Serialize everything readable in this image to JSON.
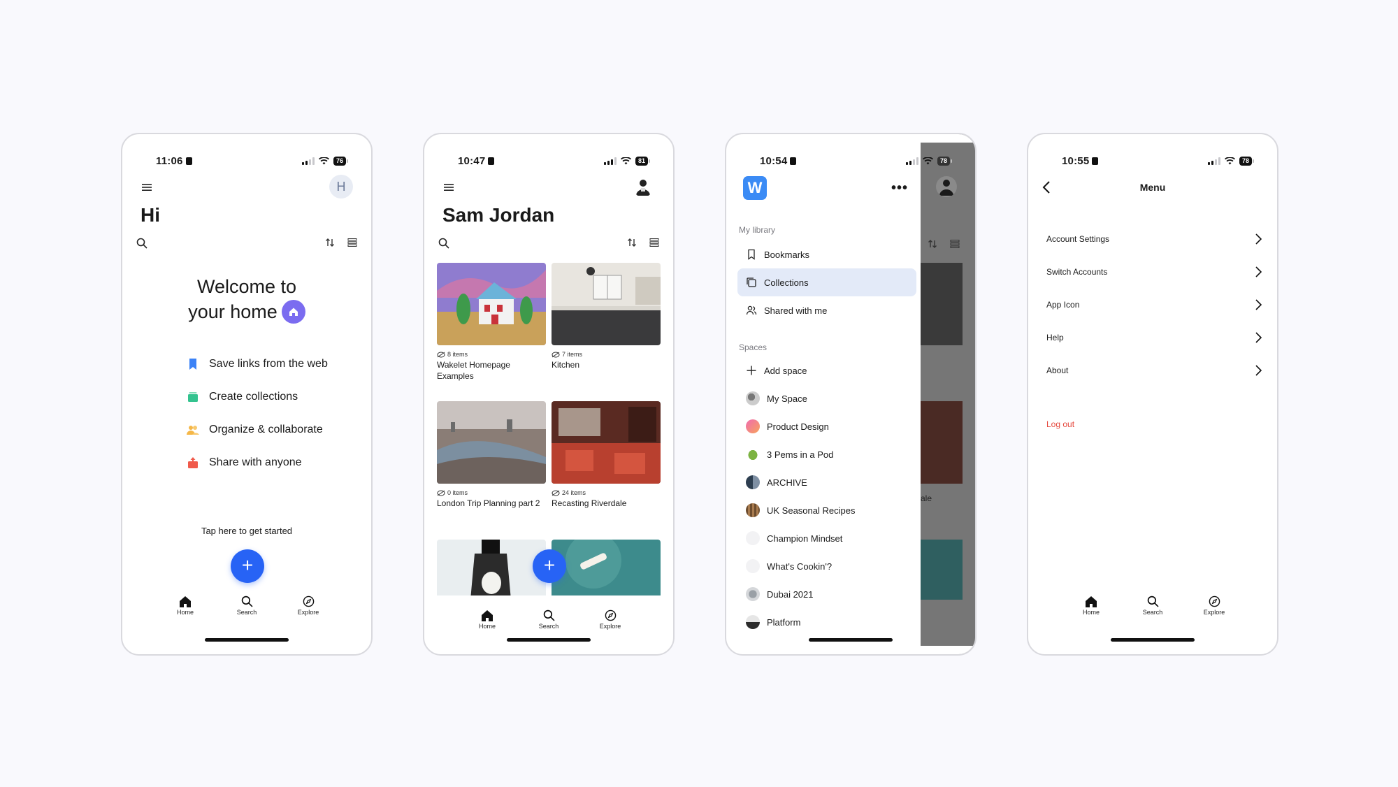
{
  "phone1": {
    "time": "11:06",
    "battery": "76",
    "avatar_initial": "H",
    "title": "Hi",
    "welcome_line1": "Welcome to",
    "welcome_line2": "your home",
    "features": [
      {
        "label": "Save links from the web",
        "icon": "bookmark-icon",
        "color": "#3b82f6"
      },
      {
        "label": "Create collections",
        "icon": "collections-icon",
        "color": "#34c38f"
      },
      {
        "label": "Organize & collaborate",
        "icon": "people-icon",
        "color": "#f5b748"
      },
      {
        "label": "Share with anyone",
        "icon": "share-icon",
        "color": "#f05a4b"
      }
    ],
    "cta": "Tap here to get started",
    "fab": "+"
  },
  "phone2": {
    "time": "10:47",
    "battery": "81",
    "title": "Sam Jordan",
    "collections": [
      {
        "count": "8 items",
        "title": "Wakelet Homepage Examples"
      },
      {
        "count": "7 items",
        "title": "Kitchen"
      },
      {
        "count": "0 items",
        "title": "London Trip Planning part 2"
      },
      {
        "count": "24 items",
        "title": "Recasting Riverdale"
      }
    ],
    "fab": "+"
  },
  "phone3": {
    "time": "10:54",
    "battery": "78",
    "logo": "W",
    "more": "•••",
    "library_label": "My library",
    "library": [
      {
        "label": "Bookmarks",
        "icon": "bookmark-outline-icon"
      },
      {
        "label": "Collections",
        "icon": "collections-outline-icon"
      },
      {
        "label": "Shared with me",
        "icon": "shared-people-icon"
      }
    ],
    "spaces_label": "Spaces",
    "spaces": [
      {
        "label": "Add space",
        "icon": "plus-icon"
      },
      {
        "label": "My Space",
        "icon": "space-avatar-icon"
      },
      {
        "label": "Product Design",
        "icon": "space-avatar-icon"
      },
      {
        "label": "3 Pems in a Pod",
        "icon": "space-avatar-icon"
      },
      {
        "label": "ARCHIVE",
        "icon": "space-avatar-icon"
      },
      {
        "label": "UK Seasonal Recipes",
        "icon": "space-avatar-icon"
      },
      {
        "label": "Champion Mindset",
        "icon": "space-avatar-icon"
      },
      {
        "label": "What's Cookin'?",
        "icon": "space-avatar-icon"
      },
      {
        "label": "Dubai 2021",
        "icon": "space-avatar-icon"
      },
      {
        "label": "Platform",
        "icon": "space-avatar-icon"
      }
    ],
    "peek_text": "ale",
    "accent": "#3b8bf5",
    "selected_bg": "#e3eaf8"
  },
  "phone4": {
    "time": "10:55",
    "battery": "78",
    "title": "Menu",
    "items": [
      "Account Settings",
      "Switch Accounts",
      "App Icon",
      "Help",
      "About"
    ],
    "logout": "Log out",
    "logout_color": "#e5483d"
  },
  "tabbar": {
    "home": "Home",
    "search": "Search",
    "explore": "Explore"
  },
  "colors": {
    "fab": "#2763f5",
    "background": "#f9f9fd"
  }
}
